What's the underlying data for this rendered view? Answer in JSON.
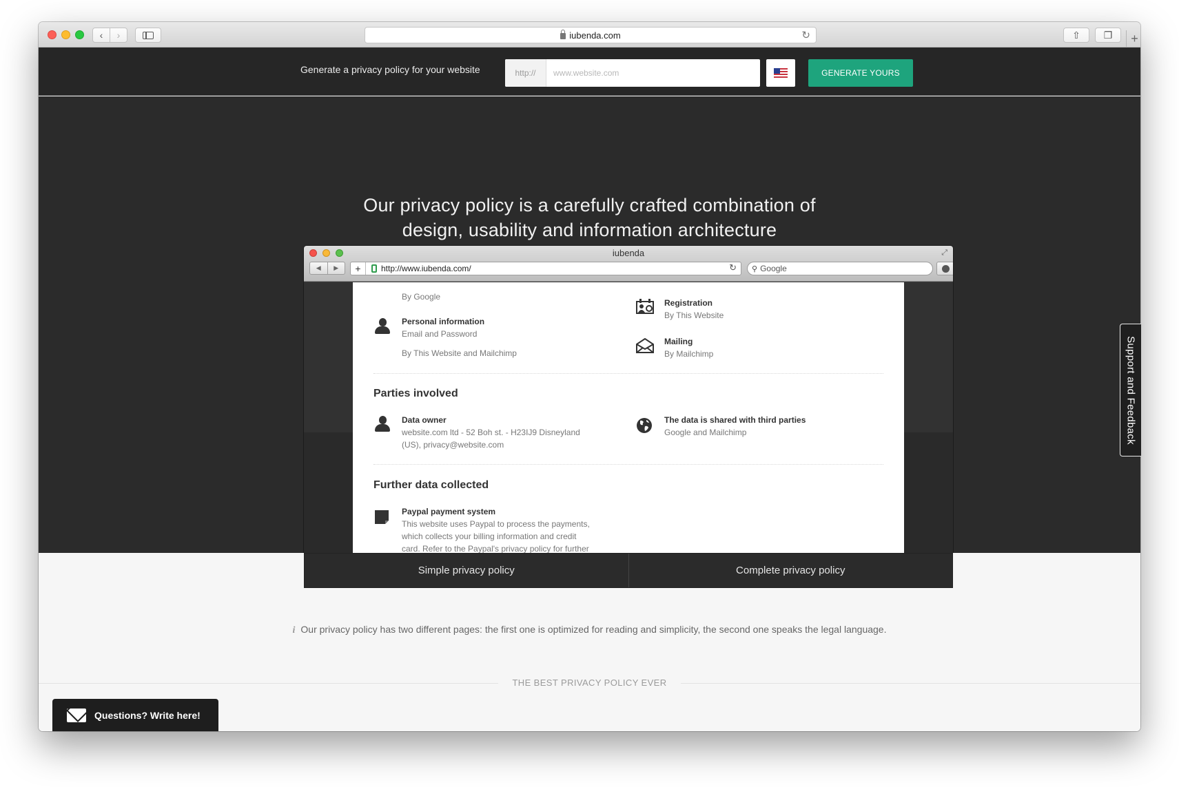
{
  "browser": {
    "url_display": "iubenda.com",
    "colors": {
      "red": "#fc5f57",
      "yellow": "#fdbc2e",
      "green": "#29c841"
    }
  },
  "topbar": {
    "label": "Generate a privacy policy for your website",
    "url_prefix": "http://",
    "url_placeholder": "www.website.com",
    "flag_icon": "us-flag-icon",
    "generate_button": "GENERATE YOURS",
    "accent": "#1ea47d"
  },
  "hero": {
    "title_line1": "Our privacy policy is a carefully crafted combination of",
    "title_line2": "design, usability and information architecture"
  },
  "mockup": {
    "window_title": "iubenda",
    "url": "http://www.iubenda.com/",
    "search_placeholder": "Google"
  },
  "policy": {
    "top_left": {
      "text": "By Google"
    },
    "personal_info": {
      "title": "Personal information",
      "line1": "Email and Password",
      "line2": "By This Website and Mailchimp"
    },
    "registration": {
      "title": "Registration",
      "sub": "By This Website"
    },
    "mailing": {
      "title": "Mailing",
      "sub": "By Mailchimp"
    },
    "parties_heading": "Parties involved",
    "data_owner": {
      "title": "Data owner",
      "line1": "website.com ltd - 52 Boh st. - H23IJ9 Disneyland",
      "line2": "(US), privacy@website.com"
    },
    "third_parties": {
      "title": "The data is shared with third parties",
      "sub": "Google and Mailchimp"
    },
    "further_heading": "Further data collected",
    "paypal": {
      "title": "Paypal payment system",
      "line1": "This website uses Paypal to process the payments,",
      "line2": "which collects your billing information and credit",
      "line3": "card. Refer to the Paypal's privacy policy for further"
    }
  },
  "tabs": {
    "simple": "Simple privacy policy",
    "complete": "Complete privacy policy"
  },
  "note": "Our privacy policy has two different pages: the first one is optimized for reading and simplicity, the second one speaks the legal language.",
  "best": "THE BEST PRIVACY POLICY EVER",
  "support": "Support and Feedback",
  "questions": "Questions? Write here!"
}
